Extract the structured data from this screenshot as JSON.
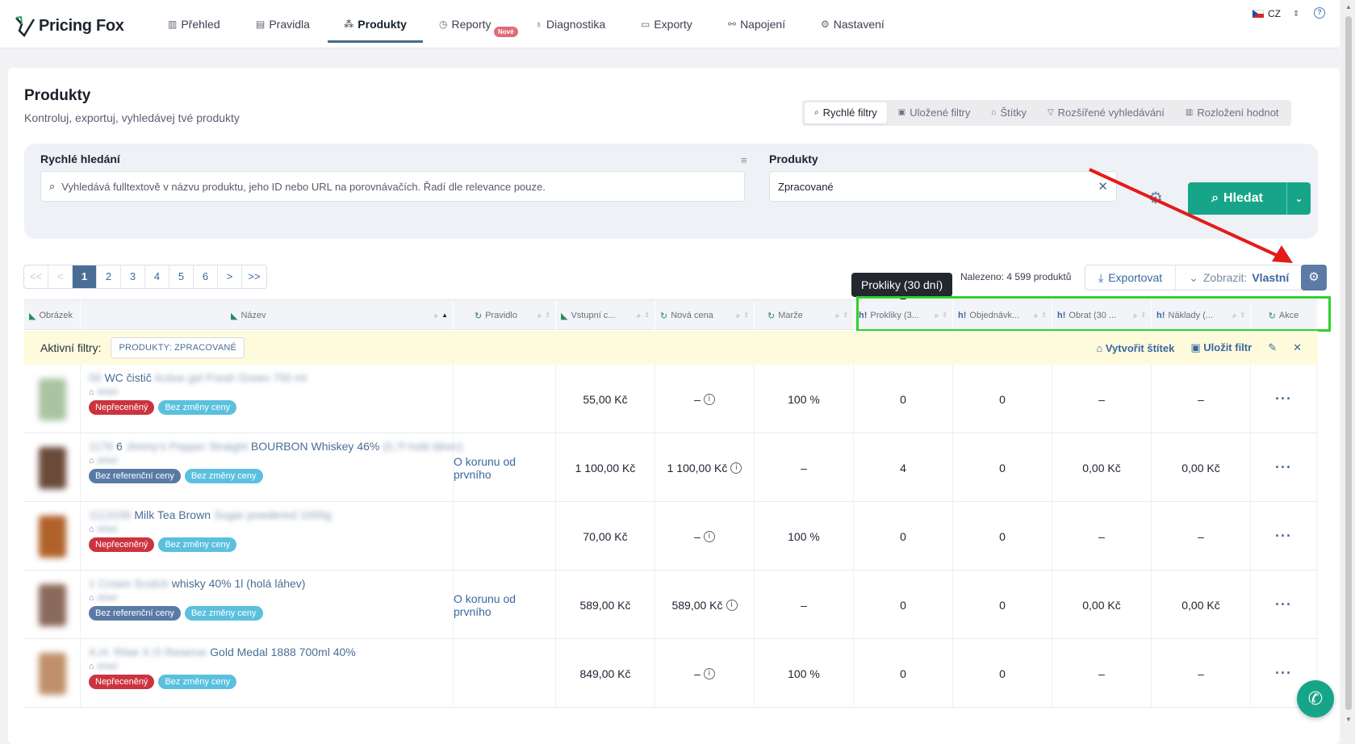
{
  "app": {
    "name": "Pricing Fox"
  },
  "nav": {
    "items": [
      {
        "label": "Přehled",
        "icon": "chart-icon"
      },
      {
        "label": "Pravidla",
        "icon": "rules-icon"
      },
      {
        "label": "Produkty",
        "icon": "products-icon"
      },
      {
        "label": "Reporty",
        "icon": "report-icon"
      },
      {
        "label": "Diagnostika",
        "icon": "stethoscope-icon"
      },
      {
        "label": "Exporty",
        "icon": "export-icon"
      },
      {
        "label": "Napojení",
        "icon": "connection-icon"
      },
      {
        "label": "Nastavení",
        "icon": "gear-icon"
      }
    ],
    "new_badge": "Nové",
    "language": "CZ",
    "help": "?"
  },
  "page": {
    "title": "Produkty",
    "subtitle": "Kontroluj, exportuj, vyhledávej tvé produkty"
  },
  "filter_tabs": [
    {
      "label": "Rychlé filtry",
      "icon": "search-icon"
    },
    {
      "label": "Uložené filtry",
      "icon": "save-icon"
    },
    {
      "label": "Štítky",
      "icon": "tag-icon"
    },
    {
      "label": "Rozšířené vyhledávání",
      "icon": "filter-icon"
    },
    {
      "label": "Rozložení hodnot",
      "icon": "bars-icon"
    }
  ],
  "search": {
    "quick_label": "Rychlé hledání",
    "quick_placeholder": "Vyhledává fulltextově v názvu produktu, jeho ID nebo URL na porovnávačích. Řadí dle relevance pouze.",
    "products_label": "Produkty",
    "products_value": "Zpracované",
    "submit_label": "Hledat"
  },
  "pagination": {
    "first": "<<",
    "prev": "<",
    "pages": [
      "1",
      "2",
      "3",
      "4",
      "5",
      "6"
    ],
    "next": ">",
    "last": ">>",
    "current": "1"
  },
  "results": {
    "found_text": "Nalezeno: 4 599 produktů",
    "export_label": "Exportovat",
    "view_prefix": "Zobrazit:",
    "view_value": "Vlastní"
  },
  "tooltip": "Prokliky (30 dní)",
  "columns": [
    {
      "label": "Obrázek"
    },
    {
      "label": "Název"
    },
    {
      "label": "Pravidlo"
    },
    {
      "label": "Vstupní c..."
    },
    {
      "label": "Nová cena"
    },
    {
      "label": "Marže"
    },
    {
      "label": "Prokliky (3..."
    },
    {
      "label": "Objednávk..."
    },
    {
      "label": "Obrat (30 ..."
    },
    {
      "label": "Náklady (..."
    },
    {
      "label": "Akce"
    }
  ],
  "active_filters": {
    "label": "Aktivní filtry:",
    "chip": "PRODUKTY: ZPRACOVANÉ",
    "create_tag": "Vytvořit štítek",
    "save_filter": "Uložit filtr"
  },
  "rows": [
    {
      "name_pre": "00",
      "name_visible": "WC čistič",
      "name_post": "Active gel Fresh Green 750 ml",
      "tag": "sklad",
      "badges": [
        "Nepřeceněný",
        "Bez změny ceny"
      ],
      "rule": "",
      "input_price": "55,00 Kč",
      "new_price": "–",
      "margin": "100 %",
      "clicks": "0",
      "orders": "0",
      "revenue": "–",
      "costs": "–",
      "img_color": "#a9c4a0"
    },
    {
      "name_pre": "1176",
      "name_visible": "6",
      "name_mid": "Jimmy's Pepper Straight",
      "name_visible2": "BOURBON Whiskey 46%",
      "name_post": "(0,7l holá láhev)",
      "tag": "sklad",
      "badges": [
        "Bez referenční ceny",
        "Bez změny ceny"
      ],
      "rule": "O korunu od prvního",
      "input_price": "1 100,00 Kč",
      "new_price": "1 100,00 Kč",
      "margin": "–",
      "clicks": "4",
      "orders": "0",
      "revenue": "0,00 Kč",
      "costs": "0,00 Kč",
      "img_color": "#6b4a3a"
    },
    {
      "name_pre": "1113156",
      "name_visible": "Milk Tea Brown",
      "name_post": "Sugar powdered 1000g",
      "tag": "sklad",
      "badges": [
        "Nepřeceněný",
        "Bez změny ceny"
      ],
      "rule": "",
      "input_price": "70,00 Kč",
      "new_price": "–",
      "margin": "100 %",
      "clicks": "0",
      "orders": "0",
      "revenue": "–",
      "costs": "–",
      "img_color": "#b0622a"
    },
    {
      "name_pre": "1 Crown Scotch",
      "name_visible": "whisky 40% 1l (holá láhev)",
      "name_post": "",
      "tag": "sklad",
      "badges": [
        "Bez referenční ceny",
        "Bez změny ceny"
      ],
      "rule": "O korunu od prvního",
      "input_price": "589,00 Kč",
      "new_price": "589,00 Kč",
      "margin": "–",
      "clicks": "0",
      "orders": "0",
      "revenue": "0,00 Kč",
      "costs": "0,00 Kč",
      "img_color": "#8a6a5a"
    },
    {
      "name_pre": "A.H. Riise X.O Reserve",
      "name_visible": "Gold Medal 1888 700ml 40%",
      "name_post": "",
      "tag": "sklad",
      "badges": [
        "Nepřeceněný",
        "Bez změny ceny"
      ],
      "rule": "",
      "input_price": "849,00 Kč",
      "new_price": "–",
      "margin": "100 %",
      "clicks": "0",
      "orders": "0",
      "revenue": "–",
      "costs": "–",
      "img_color": "#c0906a"
    }
  ],
  "colors": {
    "primary": "#17a589",
    "accent": "#4a6d96",
    "red_badge": "#cc3340",
    "cyan_badge": "#5bc0de",
    "highlight_box": "#2fd02f",
    "annotation_arrow": "#e31b1b"
  }
}
